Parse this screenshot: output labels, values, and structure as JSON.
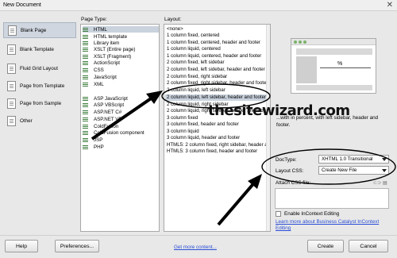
{
  "window": {
    "title": "New Document",
    "close_glyph": "✕"
  },
  "sidebar": {
    "items": [
      {
        "label": "Blank Page",
        "icon": "blank-page-icon",
        "selected": true
      },
      {
        "label": "Blank Template",
        "icon": "blank-template-icon"
      },
      {
        "label": "Fluid Grid Layout",
        "icon": "fluid-grid-icon"
      },
      {
        "label": "Page from Template",
        "icon": "page-from-template-icon"
      },
      {
        "label": "Page from Sample",
        "icon": "page-from-sample-icon"
      },
      {
        "label": "Other",
        "icon": "other-icon"
      }
    ]
  },
  "page_type": {
    "label": "Page Type:",
    "items": [
      "HTML",
      "HTML template",
      "Library item",
      "XSLT (Entire page)",
      "XSLT (Fragment)",
      "ActionScript",
      "CSS",
      "JavaScript",
      "XML",
      "ASP JavaScript",
      "ASP VBScript",
      "ASP.NET C#",
      "ASP.NET VB",
      "ColdFusion",
      "ColdFusion component",
      "JSP",
      "PHP"
    ],
    "selected_index": 0
  },
  "layout": {
    "label": "Layout:",
    "items": [
      "<none>",
      "1 column fixed, centered",
      "1 column fixed, centered, header and footer",
      "1 column liquid, centered",
      "1 column liquid, centered, header and footer",
      "2 column fixed, left sidebar",
      "2 column fixed, left sidebar, header and footer",
      "2 column fixed, right sidebar",
      "2 column fixed, right sidebar, header and footer",
      "2 column liquid, left sidebar",
      "2 column liquid, left sidebar, header and footer",
      "2 column liquid, right sidebar",
      "2 column liquid, right sidebar, header and footer",
      "3 column fixed",
      "3 column fixed, header and footer",
      "3 column liquid",
      "3 column liquid, header and footer",
      "HTML5: 2 column fixed, right sidebar, header and footer",
      "HTML5: 3 column fixed, header and footer"
    ],
    "selected_index": 10
  },
  "preview": {
    "percent_label": "%"
  },
  "description": "ht sidebar, header and footer",
  "description_lead": "...with in percent, with left sidebar, header and footer.",
  "doctype": {
    "label": "DocType:",
    "value": "XHTML 1.0 Transitional"
  },
  "layout_css": {
    "label": "Layout CSS:",
    "value": "Create New File"
  },
  "attach_css": {
    "label": "Attach CSS file:"
  },
  "incontext": {
    "label": "Enable InContext Editing",
    "checked": false
  },
  "learn_more": "Learn more about Business Catalyst InContext Editing",
  "buttons": {
    "help": "Help",
    "preferences": "Preferences...",
    "get_more": "Get more content...",
    "create": "Create",
    "cancel": "Cancel"
  },
  "watermark": "thesitewizard.com",
  "colors": {
    "accent_link": "#2a4ed6",
    "selection": "#c9d2dd",
    "annotation": "#000000"
  }
}
